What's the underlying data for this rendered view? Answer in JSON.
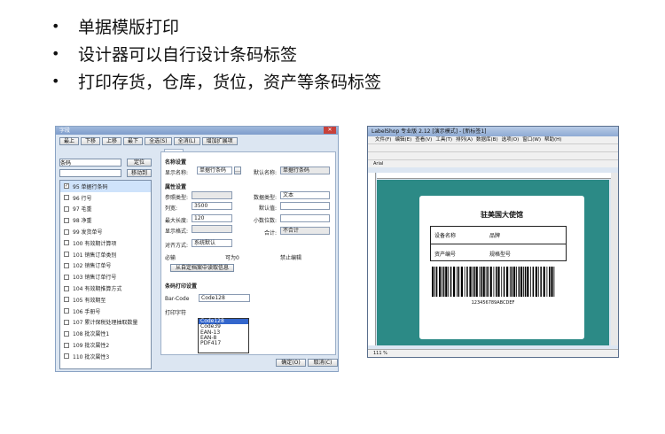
{
  "bullets": [
    "单据模版打印",
    "设计器可以自行设计条码标签",
    "打印存货，仓库，货位，资产等条码标签"
  ],
  "dialog": {
    "title": "字段",
    "toolbar": [
      "最上",
      "下移",
      "上移",
      "最下",
      "全选(S)",
      "全消(L)",
      "增加扩展项"
    ],
    "search_value": "条码",
    "locate_btn": "定位",
    "move_btn": "移动到",
    "tab": "普通",
    "list": [
      {
        "num": "95",
        "name": "单据行条码",
        "checked": true
      },
      {
        "num": "96",
        "name": "行号",
        "checked": false
      },
      {
        "num": "97",
        "name": "毛重",
        "checked": false
      },
      {
        "num": "98",
        "name": "净重",
        "checked": false
      },
      {
        "num": "99",
        "name": "发货单号",
        "checked": false
      },
      {
        "num": "100",
        "name": "有效期计算项",
        "checked": false
      },
      {
        "num": "101",
        "name": "销售订单类别",
        "checked": false
      },
      {
        "num": "102",
        "name": "销售订单号",
        "checked": false
      },
      {
        "num": "103",
        "name": "销售订单行号",
        "checked": false
      },
      {
        "num": "104",
        "name": "有效期推算方式",
        "checked": false
      },
      {
        "num": "105",
        "name": "有效期至",
        "checked": false
      },
      {
        "num": "106",
        "name": "手册号",
        "checked": false
      },
      {
        "num": "107",
        "name": "累计保税处理抽取数量",
        "checked": false
      },
      {
        "num": "108",
        "name": "批次属性1",
        "checked": false
      },
      {
        "num": "109",
        "name": "批次属性2",
        "checked": false
      },
      {
        "num": "110",
        "name": "批次属性3",
        "checked": false
      }
    ],
    "sec_name": "名称设置",
    "lbl_display_name": "显示名称:",
    "val_display_name": "单据行条码",
    "lbl_default_name": "默认名称:",
    "val_default_name": "单据行条码",
    "sec_prop": "属性设置",
    "lbl_ref_type": "参照类型:",
    "lbl_data_type": "数据类型:",
    "val_data_type": "文本",
    "lbl_width": "列宽:",
    "val_width": "3500",
    "lbl_default_val": "默认值:",
    "lbl_maxlen": "最大长度:",
    "val_maxlen": "120",
    "lbl_decimals": "小数位数:",
    "lbl_format": "显示格式:",
    "lbl_total": "合计:",
    "val_total": "不合计",
    "lbl_align": "对齐方式:",
    "val_align": "系统默认",
    "chk_required": "必输",
    "chk_editable": "可为0",
    "chk_noedit": "禁止编辑",
    "btn_read": "从自定档案中读取信息",
    "sec_print": "条码打印设置",
    "chk_barcode": "Bar-Code",
    "val_barcode": "Code128",
    "chk_print_char": "打印字符",
    "barcode_options": [
      "Code128",
      "Code39",
      "EAN-13",
      "EAN-8",
      "PDF417"
    ],
    "ok": "确定(O)",
    "cancel": "取消(C)"
  },
  "labelshop": {
    "title": "LabelShop 专业版 2.12 [演示模式] - [新标签1]",
    "menu": [
      "文件(F)",
      "编辑(E)",
      "查看(V)",
      "工具(T)",
      "排列(A)",
      "数据库(B)",
      "选项(O)",
      "窗口(W)",
      "帮助(H)"
    ],
    "font": "Arial",
    "label_title": "驻美国大使馆",
    "rows": [
      [
        "设备名称",
        "品牌"
      ],
      [
        "资产编号",
        "规格型号"
      ]
    ],
    "barcode_text": "123456789ABCDEF",
    "zoom": "111 %"
  }
}
